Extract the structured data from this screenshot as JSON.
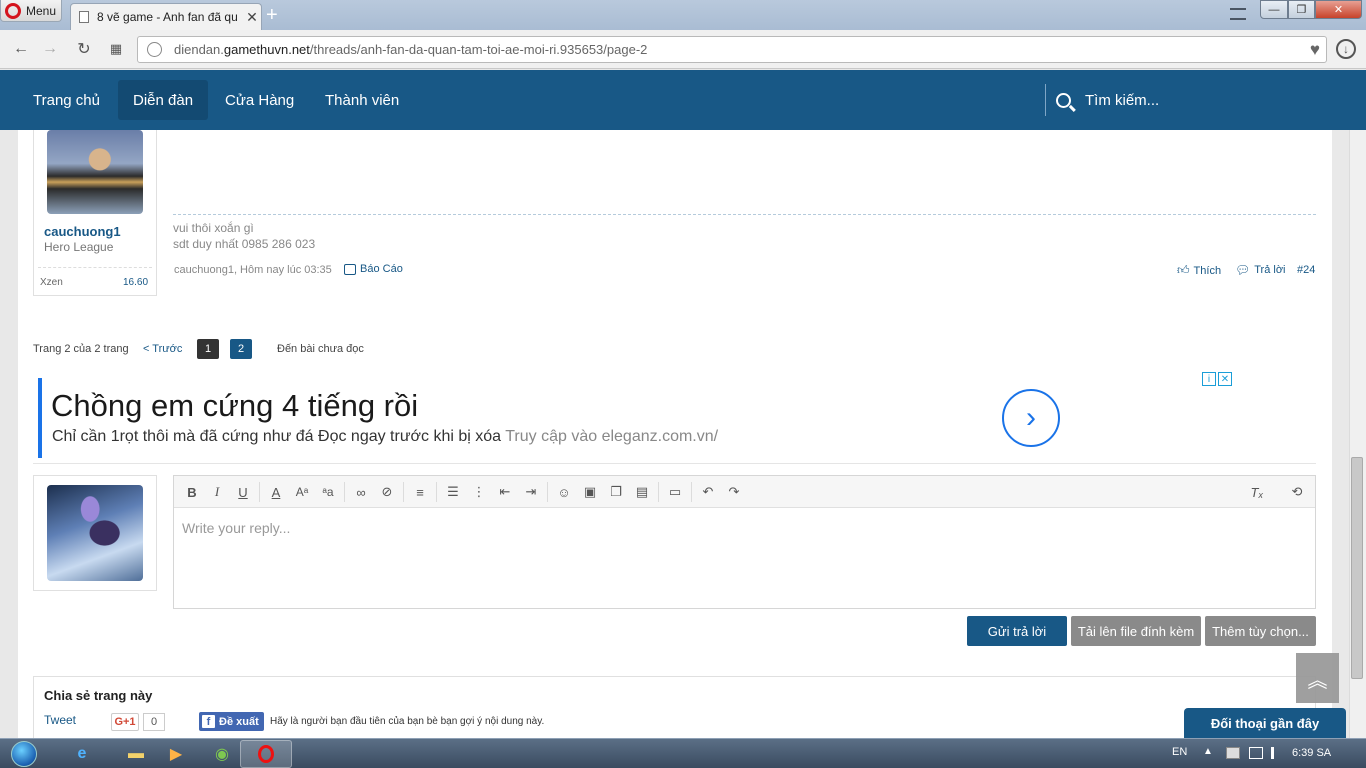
{
  "browser": {
    "menu_label": "Menu",
    "tab_title": "8 vẽ game - Anh fan đã qu",
    "url_domain_prefix": "diendan.",
    "url_domain": "gamethuvn.net",
    "url_path": "/threads/anh-fan-da-quan-tam-toi-ae-moi-ri.935653/page-2"
  },
  "site_nav": {
    "items": [
      "Trang chủ",
      "Diễn đàn",
      "Cửa Hàng",
      "Thành viên"
    ],
    "active": "Diễn đàn",
    "search_label": "Tìm kiếm..."
  },
  "post": {
    "username": "cauchuong1",
    "user_title": "Hero League",
    "stat_label": "Xzen",
    "stat_value": "16.60",
    "signature_line1": "vui thôi xoắn gì",
    "signature_line2": "sdt duy nhất 0985 286 023",
    "meta": "cauchuong1, Hôm nay lúc 03:35",
    "report_label": "Báo Cáo",
    "like_label": "Thích",
    "reply_label": "Trả lời",
    "post_number": "#24"
  },
  "pager": {
    "status": "Trang 2 của 2 trang",
    "prev": "< Trước",
    "pages": [
      "1",
      "2"
    ],
    "current_page": "2",
    "unread": "Đến bài chưa đọc"
  },
  "ad": {
    "title": "Chồng em cứng 4 tiếng rồi",
    "desc": "Chỉ cần 1rọt thôi mà đã cứng như đá Đọc ngay trước khi bị xóa",
    "url_text": "Truy cập vào eleganz.com.vn/",
    "accent": "#1a73e8"
  },
  "editor": {
    "placeholder": "Write your reply..."
  },
  "buttons": {
    "send": "Gửi trả lời",
    "upload": "Tải lên file đính kèm",
    "more": "Thêm tùy chọn..."
  },
  "share": {
    "title": "Chia sẻ trang này",
    "tweet": "Tweet",
    "gplus": "G+1",
    "gplus_count": "0",
    "fb_button": "Đề xuất",
    "fb_text": "Hãy là người bạn đầu tiên của bạn bè bạn gợi ý nội dung này."
  },
  "recent_chat": "Đối thoại gần đây",
  "taskbar": {
    "language": "EN",
    "time": "6:39 SA"
  },
  "colors": {
    "brand": "#185886",
    "brand_dark": "#134a72"
  }
}
